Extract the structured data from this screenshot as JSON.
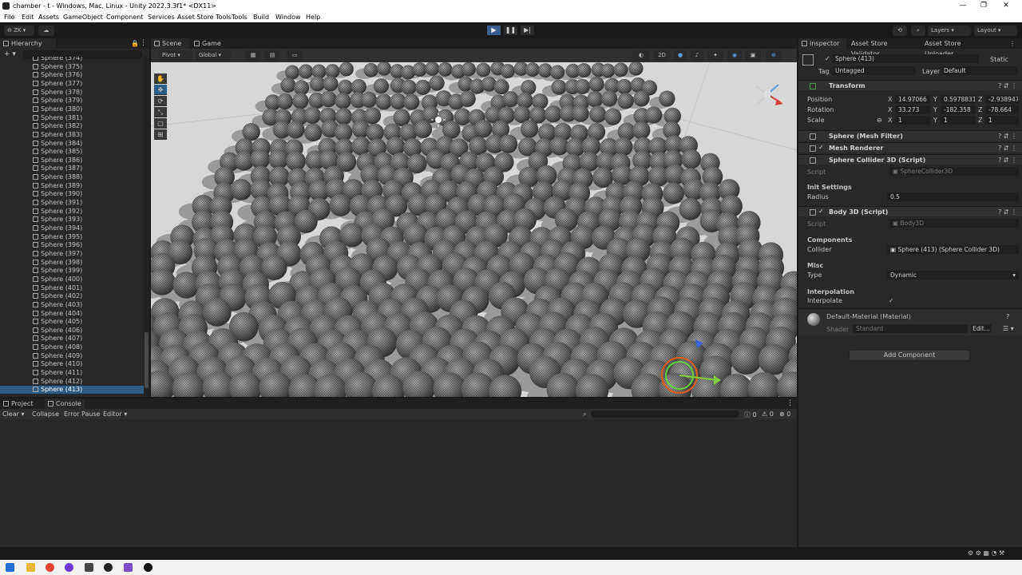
{
  "window": {
    "title": "chamber - t - Windows, Mac, Linux - Unity 2022.3.3f1* <DX11>",
    "controls": [
      "—",
      "❐",
      "✕"
    ]
  },
  "menu": [
    "File",
    "Edit",
    "Assets",
    "GameObject",
    "Component",
    "Services",
    "Asset Store Tools",
    "Tools",
    "Build",
    "Window",
    "Help"
  ],
  "toolbar": {
    "account": "⊖ ZK ▾",
    "layers": "Layers",
    "layout": "Layout"
  },
  "hierarchy": {
    "tab": "Hierarchy",
    "add": "+ ▾",
    "rows": [
      "Sphere (374)",
      "Sphere (375)",
      "Sphere (376)",
      "Sphere (377)",
      "Sphere (378)",
      "Sphere (379)",
      "Sphere (380)",
      "Sphere (381)",
      "Sphere (382)",
      "Sphere (383)",
      "Sphere (384)",
      "Sphere (385)",
      "Sphere (386)",
      "Sphere (387)",
      "Sphere (388)",
      "Sphere (389)",
      "Sphere (390)",
      "Sphere (391)",
      "Sphere (392)",
      "Sphere (393)",
      "Sphere (394)",
      "Sphere (395)",
      "Sphere (396)",
      "Sphere (397)",
      "Sphere (398)",
      "Sphere (399)",
      "Sphere (400)",
      "Sphere (401)",
      "Sphere (402)",
      "Sphere (403)",
      "Sphere (404)",
      "Sphere (405)",
      "Sphere (406)",
      "Sphere (407)",
      "Sphere (408)",
      "Sphere (409)",
      "Sphere (410)",
      "Sphere (411)",
      "Sphere (412)",
      "Sphere (413)"
    ],
    "selected": "Sphere (413)"
  },
  "scene": {
    "tabs": [
      "Scene",
      "Game"
    ],
    "pivot": "Pivot ▾",
    "global": "Global ▾",
    "mode": "2D"
  },
  "inspector": {
    "tabs": [
      "Inspector",
      "Asset Store Validator",
      "Asset Store Uploader"
    ],
    "object_name": "Sphere (413)",
    "static_label": "Static",
    "tag_label": "Tag",
    "tag_value": "Untagged",
    "layer_label": "Layer",
    "layer_value": "Default",
    "transform": {
      "title": "Transform",
      "position_label": "Position",
      "rotation_label": "Rotation",
      "scale_label": "Scale",
      "position": {
        "x": "14.97066",
        "y": "0.5978831",
        "z": "-2.938947"
      },
      "rotation": {
        "x": "33.273",
        "y": "-182.358",
        "z": "-78.664"
      },
      "scale": {
        "x": "1",
        "y": "1",
        "z": "1"
      }
    },
    "components": {
      "mesh_filter": "Sphere (Mesh Filter)",
      "mesh_renderer": "Mesh Renderer",
      "sphere_collider": "Sphere Collider 3D (Script)",
      "body": "Body 3D (Script)"
    },
    "collider_script_label": "Script",
    "collider_script_value": "SphereCollider3D",
    "init_settings": "Init Settings",
    "radius_label": "Radius",
    "radius_value": "0.5",
    "body_script_label": "Script",
    "body_script_value": "Body3D",
    "components_header": "Components",
    "collider_label": "Collider",
    "collider_value": "Sphere (413) (Sphere Collider 3D)",
    "misc_header": "Misc",
    "type_label": "Type",
    "type_value": "Dynamic",
    "interp_header": "Interpolation",
    "interp_label": "Interpolate",
    "interp_check": "✓",
    "material_name": "Default-Material (Material)",
    "shader_label": "Shader",
    "shader_value": "Standard",
    "edit_btn": "Edit...",
    "add_component": "Add Component"
  },
  "bottom": {
    "tabs": [
      "Project",
      "Console"
    ],
    "clear": "Clear ▾",
    "collapse": "Collapse",
    "error_pause": "Error Pause",
    "editor": "Editor ▾",
    "counts": {
      "info": "0",
      "warn": "0",
      "error": "0"
    }
  },
  "colors": {
    "accent": "#2c5d87",
    "play_active": "#3a5f8f",
    "panel": "#282828",
    "viewport_bg": "#d7d7d7"
  }
}
